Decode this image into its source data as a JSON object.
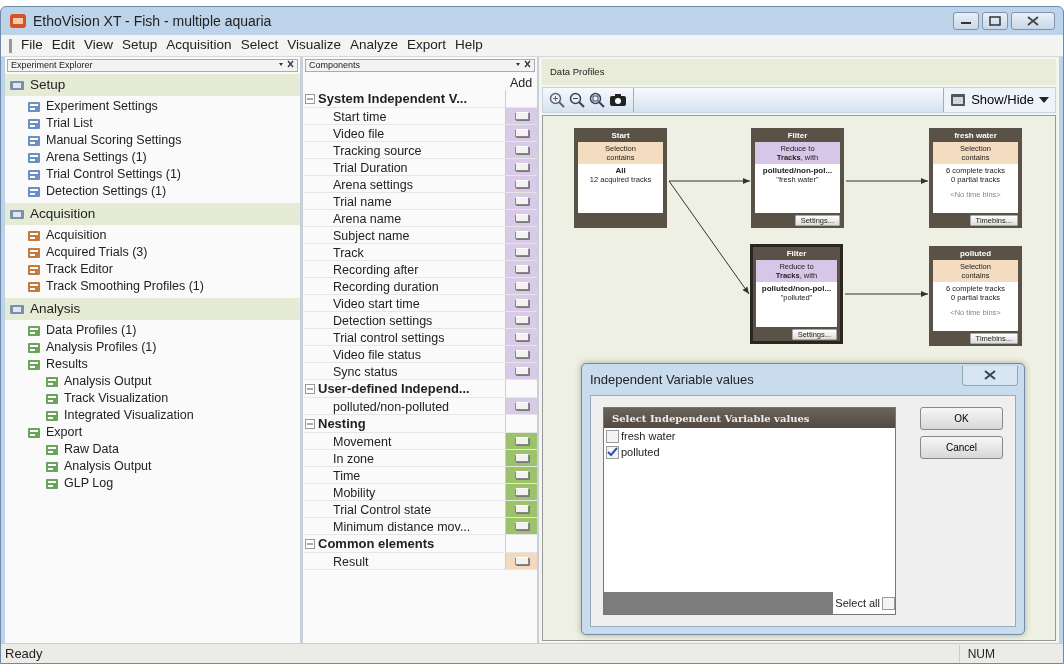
{
  "window": {
    "title": "EthoVision XT - Fish - multiple aquaria"
  },
  "menu": [
    "File",
    "Edit",
    "View",
    "Setup",
    "Acquisition",
    "Select",
    "Visualize",
    "Analyze",
    "Export",
    "Help"
  ],
  "explorer": {
    "title": "Experiment Explorer",
    "sections": [
      {
        "label": "Setup",
        "items": [
          {
            "label": "Experiment Settings"
          },
          {
            "label": "Trial List"
          },
          {
            "label": "Manual Scoring Settings"
          },
          {
            "label": "Arena Settings (1)"
          },
          {
            "label": "Trial Control Settings (1)"
          },
          {
            "label": "Detection Settings (1)"
          }
        ]
      },
      {
        "label": "Acquisition",
        "items": [
          {
            "label": "Acquisition"
          },
          {
            "label": "Acquired Trials (3)"
          },
          {
            "label": "Track Editor"
          },
          {
            "label": "Track Smoothing Profiles (1)"
          }
        ]
      },
      {
        "label": "Analysis",
        "items": [
          {
            "label": "Data Profiles (1)"
          },
          {
            "label": "Analysis Profiles (1)"
          },
          {
            "label": "Results",
            "children": [
              {
                "label": "Analysis Output"
              },
              {
                "label": "Track Visualization"
              },
              {
                "label": "Integrated Visualization"
              }
            ]
          },
          {
            "label": "Export",
            "children": [
              {
                "label": "Raw Data"
              },
              {
                "label": "Analysis Output"
              },
              {
                "label": "GLP Log"
              }
            ]
          }
        ]
      }
    ]
  },
  "components": {
    "title": "Components",
    "add_header": "Add",
    "groups": [
      {
        "label": "System Independent V...",
        "expanded": true,
        "color": "#d9cbe8",
        "items": [
          "Start time",
          "Video file",
          "Tracking source",
          "Trial Duration",
          "Arena settings",
          "Trial name",
          "Arena name",
          "Subject name",
          "Track",
          "Recording after",
          "Recording duration",
          "Video start time",
          "Detection settings",
          "Trial control settings",
          "Video file status",
          "Sync status"
        ]
      },
      {
        "label": "User-defined Independ...",
        "expanded": true,
        "color": "#d9cbe8",
        "items": [
          "polluted/non-polluted"
        ]
      },
      {
        "label": "Nesting",
        "expanded": true,
        "color": "#9cc26a",
        "items": [
          "Movement",
          "In zone",
          "Time",
          "Mobility",
          "Trial Control state",
          "Minimum distance mov..."
        ]
      },
      {
        "label": "Common elements",
        "expanded": true,
        "color": "#f3d9bd",
        "items": [
          "Result"
        ]
      }
    ]
  },
  "data_profiles": {
    "title": "Data Profiles",
    "show_hide": "Show/Hide",
    "nodes": [
      {
        "kind": "selection",
        "title": "Start",
        "selected": false,
        "header": [
          "Selection",
          "contains"
        ],
        "body": [
          {
            "text": "All",
            "kind": "heading"
          },
          {
            "text": "12 acquired tracks",
            "kind": "line"
          }
        ]
      },
      {
        "kind": "filter",
        "title": "Filter",
        "selected": false,
        "header": [
          "Reduce to",
          "**Tracks**, with"
        ],
        "body": [
          {
            "text": "polluted/non-pol...",
            "kind": "heading"
          },
          {
            "text": "\"fresh water\"",
            "kind": "line"
          }
        ],
        "button": "Settings..."
      },
      {
        "kind": "selection",
        "title": "fresh water",
        "selected": false,
        "header": [
          "Selection",
          "contains"
        ],
        "body": [
          {
            "text": "6 complete tracks",
            "kind": "line"
          },
          {
            "text": "0 partial tracks",
            "kind": "line"
          },
          {
            "text": "<No time bins>",
            "kind": "note"
          }
        ],
        "button": "Timebins..."
      },
      {
        "kind": "filter",
        "title": "Filter",
        "selected": true,
        "header": [
          "Reduce to",
          "**Tracks**, with"
        ],
        "body": [
          {
            "text": "polluted/non-pol...",
            "kind": "heading"
          },
          {
            "text": "\"polluted\"",
            "kind": "line"
          }
        ],
        "button": "Settings..."
      },
      {
        "kind": "selection",
        "title": "polluted",
        "selected": false,
        "header": [
          "Selection",
          "contains"
        ],
        "body": [
          {
            "text": "6 complete tracks",
            "kind": "line"
          },
          {
            "text": "0 partial tracks",
            "kind": "line"
          },
          {
            "text": "<No time bins>",
            "kind": "note"
          }
        ],
        "button": "Timebins..."
      }
    ]
  },
  "dialog": {
    "title": "Independent Variable values",
    "list_header": "Select Independent Variable values",
    "options": [
      {
        "label": "fresh water",
        "checked": false
      },
      {
        "label": "polluted",
        "checked": true
      }
    ],
    "select_all": {
      "label": "Select all",
      "checked": false
    },
    "ok": "OK",
    "cancel": "Cancel"
  },
  "status_bar": {
    "text": "Ready",
    "num": "NUM"
  }
}
